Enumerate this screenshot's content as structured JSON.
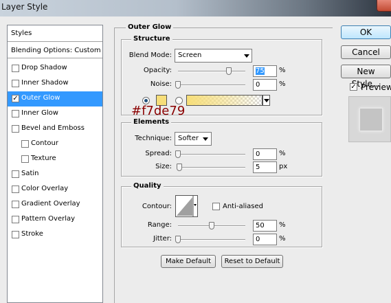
{
  "window": {
    "title": "Layer Style"
  },
  "styles_panel": {
    "header": "Styles",
    "blending_options": "Blending Options: Custom",
    "items": [
      {
        "label": "Drop Shadow",
        "checked": false,
        "indent": false,
        "selected": false
      },
      {
        "label": "Inner Shadow",
        "checked": false,
        "indent": false,
        "selected": false
      },
      {
        "label": "Outer Glow",
        "checked": true,
        "indent": false,
        "selected": true
      },
      {
        "label": "Inner Glow",
        "checked": false,
        "indent": false,
        "selected": false
      },
      {
        "label": "Bevel and Emboss",
        "checked": false,
        "indent": false,
        "selected": false
      },
      {
        "label": "Contour",
        "checked": false,
        "indent": true,
        "selected": false
      },
      {
        "label": "Texture",
        "checked": false,
        "indent": true,
        "selected": false
      },
      {
        "label": "Satin",
        "checked": false,
        "indent": false,
        "selected": false
      },
      {
        "label": "Color Overlay",
        "checked": false,
        "indent": false,
        "selected": false
      },
      {
        "label": "Gradient Overlay",
        "checked": false,
        "indent": false,
        "selected": false
      },
      {
        "label": "Pattern Overlay",
        "checked": false,
        "indent": false,
        "selected": false
      },
      {
        "label": "Stroke",
        "checked": false,
        "indent": false,
        "selected": false
      }
    ]
  },
  "outer_glow": {
    "title": "Outer Glow",
    "structure": {
      "title": "Structure",
      "blend_mode_label": "Blend Mode:",
      "blend_mode_value": "Screen",
      "opacity_label": "Opacity:",
      "opacity_value": "75",
      "opacity_unit": "%",
      "opacity_level": 0.75,
      "noise_label": "Noise:",
      "noise_value": "0",
      "noise_unit": "%",
      "noise_level": 0,
      "glow_color": "#f7de79",
      "color_annotation": "#f7de79",
      "color_mode": "solid"
    },
    "elements": {
      "title": "Elements",
      "technique_label": "Technique:",
      "technique_value": "Softer",
      "spread_label": "Spread:",
      "spread_value": "0",
      "spread_unit": "%",
      "spread_level": 0,
      "size_label": "Size:",
      "size_value": "5",
      "size_unit": "px",
      "size_level": 0.02
    },
    "quality": {
      "title": "Quality",
      "contour_label": "Contour:",
      "anti_aliased_label": "Anti-aliased",
      "anti_aliased_checked": false,
      "range_label": "Range:",
      "range_value": "50",
      "range_unit": "%",
      "range_level": 0.5,
      "jitter_label": "Jitter:",
      "jitter_value": "0",
      "jitter_unit": "%",
      "jitter_level": 0
    },
    "make_default_label": "Make Default",
    "reset_default_label": "Reset to Default"
  },
  "buttons": {
    "ok_label": "OK",
    "cancel_label": "Cancel",
    "new_style_label": "New Style...",
    "preview_label": "Preview",
    "preview_checked": true
  }
}
